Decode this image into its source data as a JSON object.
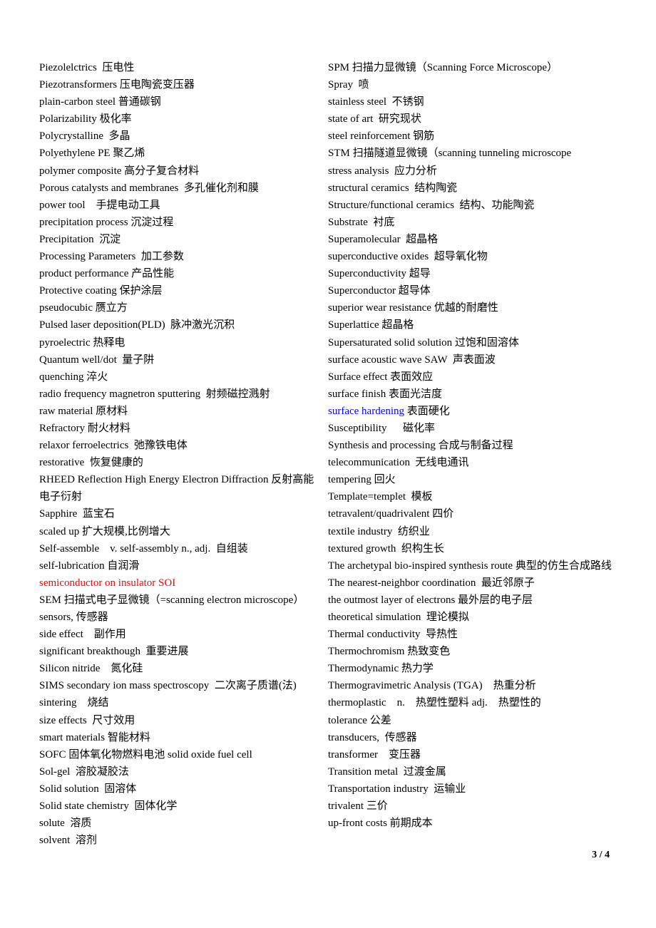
{
  "document": {
    "page_number": "3 / 4",
    "accent_colors": {
      "red": "#ff0000",
      "blue": "#0000ff"
    },
    "left_column": [
      {
        "term": "Piezolelctrics",
        "sep": "  ",
        "definition": "压电性"
      },
      {
        "term": "Piezotransformers",
        "sep": " ",
        "definition": "压电陶瓷变压器"
      },
      {
        "term": "plain-carbon steel",
        "sep": " ",
        "definition": "普通碳钢"
      },
      {
        "term": "Polarizability",
        "sep": " ",
        "definition": "极化率"
      },
      {
        "term": "Polycrystalline",
        "sep": "  ",
        "definition": "多晶"
      },
      {
        "term": "Polyethylene PE",
        "sep": " ",
        "definition": "聚乙烯"
      },
      {
        "term": "polymer composite",
        "sep": " ",
        "definition": "高分子复合材料"
      },
      {
        "term": "Porous catalysts and membranes",
        "sep": "  ",
        "definition": "多孔催化剂和膜"
      },
      {
        "term": "power tool",
        "sep": "    ",
        "definition": "手提电动工具"
      },
      {
        "term": "precipitation process",
        "sep": " ",
        "definition": "沉淀过程"
      },
      {
        "term": "Precipitation",
        "sep": "  ",
        "definition": "沉淀"
      },
      {
        "term": "Processing Parameters",
        "sep": "  ",
        "definition": "加工参数"
      },
      {
        "term": "product performance",
        "sep": " ",
        "definition": "产品性能"
      },
      {
        "term": "Protective coating",
        "sep": " ",
        "definition": "保护涂层"
      },
      {
        "term": "pseudocubic",
        "sep": " ",
        "definition": "赝立方"
      },
      {
        "term": "Pulsed laser deposition(PLD)",
        "sep": "  ",
        "definition": "脉冲激光沉积"
      },
      {
        "term": "pyroelectric",
        "sep": " ",
        "definition": "热释电"
      },
      {
        "term": "Quantum well/dot",
        "sep": "  ",
        "definition": "量子阱"
      },
      {
        "term": "quenching",
        "sep": " ",
        "definition": "淬火"
      },
      {
        "term": "radio frequency magnetron sputtering",
        "sep": "  ",
        "definition": "射频磁控溅射"
      },
      {
        "term": "raw material",
        "sep": " ",
        "definition": "原材料"
      },
      {
        "term": "Refractory",
        "sep": " ",
        "definition": "耐火材料"
      },
      {
        "term": "relaxor ferroelectrics",
        "sep": "  ",
        "definition": "弛豫铁电体"
      },
      {
        "term": "restorative",
        "sep": "  ",
        "definition": "恢复健康的"
      },
      {
        "term": "RHEED Reflection High Energy Electron Diffraction",
        "sep": "  ",
        "definition": "反射高能电子衍射",
        "wrap": true
      },
      {
        "term": "Sapphire",
        "sep": "  ",
        "definition": "蓝宝石"
      },
      {
        "term": "scaled up",
        "sep": " ",
        "definition": "扩大规模,比例增大"
      },
      {
        "term": "Self-assemble    v. self-assembly n., adj.",
        "sep": "  ",
        "definition": "自组装"
      },
      {
        "term": "self-lubrication",
        "sep": " ",
        "definition": "自润滑"
      },
      {
        "term": "semiconductor on insulator SOI",
        "sep": "",
        "definition": "",
        "color": "red"
      },
      {
        "term": "SEM",
        "sep": " ",
        "definition": "扫描式电子显微镜（=scanning electron microscope）"
      },
      {
        "term": "sensors,",
        "sep": " ",
        "definition": "传感器"
      },
      {
        "term": "side effect",
        "sep": "    ",
        "definition": "副作用"
      },
      {
        "term": "significant breakthough",
        "sep": "  ",
        "definition": "重要进展"
      },
      {
        "term": "Silicon nitride",
        "sep": "    ",
        "definition": "氮化硅"
      },
      {
        "term": "SIMS secondary ion mass spectroscopy",
        "sep": "  ",
        "definition": "二次离子质谱(法)"
      },
      {
        "term": "sintering",
        "sep": "    ",
        "definition": "烧结"
      },
      {
        "term": "size effects",
        "sep": "  ",
        "definition": "尺寸效用"
      },
      {
        "term": "smart materials",
        "sep": " ",
        "definition": "智能材料"
      },
      {
        "term": "SOFC",
        "sep": " ",
        "definition": "固体氧化物燃料电池 solid oxide fuel cell"
      },
      {
        "term": "Sol-gel",
        "sep": "  ",
        "definition": "溶胶凝胶法"
      },
      {
        "term": "Solid solution",
        "sep": "  ",
        "definition": "固溶体"
      },
      {
        "term": "Solid state chemistry",
        "sep": "  ",
        "definition": "固体化学"
      },
      {
        "term": "solute",
        "sep": "  ",
        "definition": "溶质"
      },
      {
        "term": "solvent",
        "sep": "  ",
        "definition": "溶剂"
      }
    ],
    "right_column": [
      {
        "term": "SPM",
        "sep": " ",
        "definition": "扫描力显微镜（Scanning Force Microscope）"
      },
      {
        "term": "Spray",
        "sep": "  ",
        "definition": "喷"
      },
      {
        "term": "stainless steel",
        "sep": "  ",
        "definition": "不锈钢"
      },
      {
        "term": "state of art",
        "sep": "  ",
        "definition": "研究现状"
      },
      {
        "term": "steel reinforcement",
        "sep": " ",
        "definition": "钢筋"
      },
      {
        "term": "STM",
        "sep": " ",
        "definition": "扫描隧道显微镜（scanning tunneling microscope"
      },
      {
        "term": "stress analysis",
        "sep": "  ",
        "definition": "应力分析"
      },
      {
        "term": "structural ceramics",
        "sep": "  ",
        "definition": "结构陶瓷"
      },
      {
        "term": "Structure/functional ceramics",
        "sep": "  ",
        "definition": "结构、功能陶瓷"
      },
      {
        "term": "Substrate",
        "sep": "  ",
        "definition": "衬底"
      },
      {
        "term": "Superamolecular",
        "sep": "  ",
        "definition": "超晶格"
      },
      {
        "term": "superconductive oxides",
        "sep": "  ",
        "definition": "超导氧化物"
      },
      {
        "term": "Superconductivity",
        "sep": " ",
        "definition": "超导"
      },
      {
        "term": "Superconductor",
        "sep": " ",
        "definition": "超导体"
      },
      {
        "term": "superior wear resistance",
        "sep": " ",
        "definition": "优越的耐磨性"
      },
      {
        "term": "Superlattice",
        "sep": " ",
        "definition": "超晶格"
      },
      {
        "term": "Supersaturated solid solution",
        "sep": " ",
        "definition": "过饱和固溶体"
      },
      {
        "term": "surface acoustic wave SAW",
        "sep": "  ",
        "definition": "声表面波"
      },
      {
        "term": "Surface effect",
        "sep": " ",
        "definition": "表面效应"
      },
      {
        "term": "surface finish",
        "sep": " ",
        "definition": "表面光洁度"
      },
      {
        "term": "surface hardening",
        "sep": " ",
        "definition": "表面硬化",
        "color": "blue"
      },
      {
        "term": "Susceptibility",
        "sep": "      ",
        "definition": "磁化率"
      },
      {
        "term": "Synthesis and processing",
        "sep": " ",
        "definition": "合成与制备过程"
      },
      {
        "term": "telecommunication",
        "sep": "  ",
        "definition": "无线电通讯"
      },
      {
        "term": "tempering",
        "sep": " ",
        "definition": "回火"
      },
      {
        "term": "Template=templet",
        "sep": "  ",
        "definition": "模板"
      },
      {
        "term": "tetravalent/quadrivalent",
        "sep": " ",
        "definition": "四价"
      },
      {
        "term": "textile industry",
        "sep": "  ",
        "definition": "纺织业"
      },
      {
        "term": "textured growth",
        "sep": "  ",
        "definition": "织构生长"
      },
      {
        "term": "The archetypal bio-inspired synthesis route",
        "sep": "  ",
        "definition": "典型的仿生合成路线",
        "wrap": true
      },
      {
        "term": "The nearest-neighbor coordination",
        "sep": "  ",
        "definition": "最近邻原子"
      },
      {
        "term": "the outmost layer of electrons",
        "sep": " ",
        "definition": "最外层的电子层"
      },
      {
        "term": "theoretical simulation",
        "sep": "  ",
        "definition": "理论模拟"
      },
      {
        "term": "Thermal conductivity",
        "sep": "  ",
        "definition": "导热性"
      },
      {
        "term": "Thermochromism",
        "sep": " ",
        "definition": "热致变色"
      },
      {
        "term": "Thermodynamic",
        "sep": " ",
        "definition": "热力学"
      },
      {
        "term": "Thermogravimetric Analysis (TGA)",
        "sep": "    ",
        "definition": "热重分析"
      },
      {
        "term": "thermoplastic    n.",
        "sep": "    ",
        "definition": "热塑性塑料 adj.    热塑性的"
      },
      {
        "term": "tolerance",
        "sep": " ",
        "definition": "公差"
      },
      {
        "term": "transducers,",
        "sep": "  ",
        "definition": "传感器"
      },
      {
        "term": "transformer",
        "sep": "    ",
        "definition": "变压器"
      },
      {
        "term": "Transition metal",
        "sep": "  ",
        "definition": "过渡金属"
      },
      {
        "term": "Transportation industry",
        "sep": "  ",
        "definition": "运输业"
      },
      {
        "term": "trivalent",
        "sep": " ",
        "definition": "三价"
      },
      {
        "term": "up-front costs",
        "sep": " ",
        "definition": "前期成本"
      }
    ]
  }
}
